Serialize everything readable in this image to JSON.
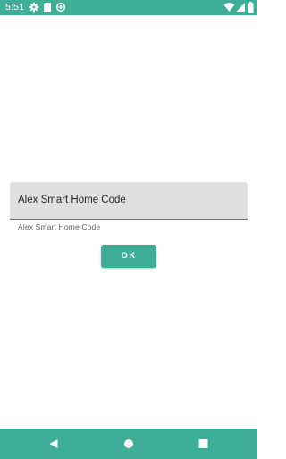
{
  "status_bar": {
    "time": "5:51",
    "left_icons": [
      "gear-icon",
      "sd-card-icon",
      "data-saver-icon"
    ],
    "right_icons": [
      "wifi-icon",
      "signal-icon",
      "battery-icon"
    ],
    "color": "#3fae99"
  },
  "form": {
    "field_value": "Alex Smart Home Code",
    "helper_text": "Alex Smart Home Code",
    "ok_label": "OK"
  },
  "nav_bar": {
    "buttons": [
      "back-icon",
      "home-icon",
      "recents-icon"
    ],
    "color": "#3fae99"
  }
}
